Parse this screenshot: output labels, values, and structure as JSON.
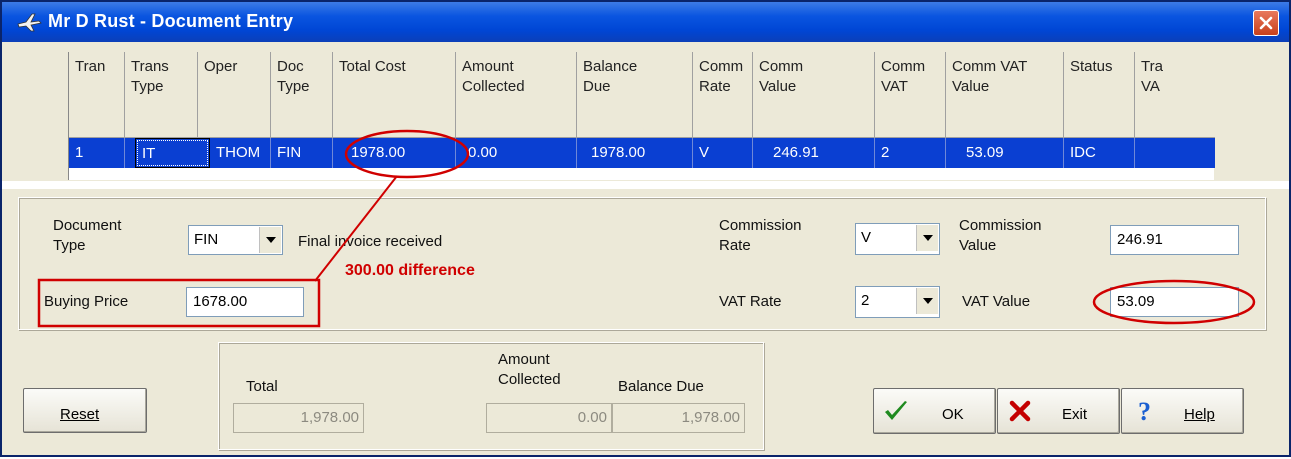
{
  "window": {
    "title": "Mr D Rust - Document Entry"
  },
  "grid": {
    "columns": [
      "Tran",
      "Trans\nType",
      "Oper",
      "Doc\nType",
      "Total Cost",
      "Amount\nCollected",
      "Balance\nDue",
      "Comm\nRate",
      "Comm\nValue",
      "Comm\nVAT",
      "Comm VAT\nValue",
      "Status",
      "Tra\nVA"
    ],
    "row": [
      "1",
      "IT",
      "THOM",
      "FIN",
      "1978.00",
      "0.00",
      "1978.00",
      "V",
      "246.91",
      "2",
      "53.09",
      "IDC",
      ""
    ]
  },
  "form": {
    "document_type_label": "Document\nType",
    "document_type_value": "FIN",
    "document_type_desc": "Final invoice received",
    "buying_price_label": "Buying Price",
    "buying_price_value": "1678.00",
    "commission_rate_label": "Commission\nRate",
    "commission_rate_value": "V",
    "commission_value_label": "Commission\nValue",
    "commission_value": "246.91",
    "vat_rate_label": "VAT Rate",
    "vat_rate_value": "2",
    "vat_value_label": "VAT Value",
    "vat_value": "53.09"
  },
  "totals": {
    "total_label": "Total",
    "total_value": "1,978.00",
    "amount_collected_label": "Amount\nCollected",
    "amount_collected_value": "0.00",
    "balance_due_label": "Balance Due",
    "balance_due_value": "1,978.00"
  },
  "buttons": {
    "reset": "Reset",
    "ok": "OK",
    "exit": "Exit",
    "help": "Help"
  },
  "annotation": {
    "difference_text": "300.00 difference",
    "color": "#d00000"
  }
}
